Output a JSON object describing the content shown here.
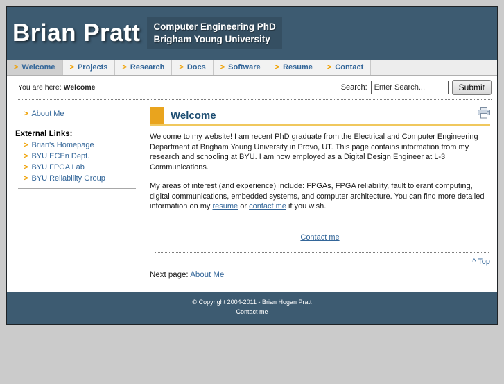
{
  "colors": {
    "header_bg": "#3d5b71",
    "accent_square": "#e9a41e",
    "accent_underline": "#f0c85e",
    "arrow_orange": "#efa000",
    "link_blue": "#336699",
    "page_bg": "#cbcbcb"
  },
  "header": {
    "title": "Brian Pratt",
    "subtitle_line1": "Computer Engineering PhD",
    "subtitle_line2": "Brigham Young University"
  },
  "nav": {
    "items": [
      {
        "label": "Welcome",
        "active": true
      },
      {
        "label": "Projects",
        "active": false
      },
      {
        "label": "Research",
        "active": false
      },
      {
        "label": "Docs",
        "active": false
      },
      {
        "label": "Software",
        "active": false
      },
      {
        "label": "Resume",
        "active": false
      },
      {
        "label": "Contact",
        "active": false
      }
    ]
  },
  "breadcrumb": {
    "prefix": "You are here:",
    "current": "Welcome"
  },
  "search": {
    "label": "Search:",
    "placeholder": "Enter Search...",
    "submit_label": "Submit"
  },
  "sidebar": {
    "about_link": "About Me",
    "external_links_heading": "External Links:",
    "links": [
      "Brian's Homepage",
      "BYU ECEn Dept.",
      "BYU FPGA Lab",
      "BYU Reliability Group"
    ]
  },
  "main": {
    "heading": "Welcome",
    "paragraph1": "Welcome to my website! I am recent PhD graduate from the Electrical and Computer Engineering Department at Brigham Young University in Provo, UT. This page contains information from my research and schooling at BYU. I am now employed as a Digital Design Engineer at L-3 Communications.",
    "paragraph2_pre": "My areas of interest (and experience) include: FPGAs, FPGA reliability, fault tolerant computing, digital communications, embedded systems, and computer architecture.  You can find more detailed information on my ",
    "resume_link": "resume",
    "paragraph2_mid": " or ",
    "contact_link": "contact me",
    "paragraph2_post": " if you wish.",
    "center_contact_link": "Contact me",
    "top_link": "^ Top",
    "next_page_label": "Next page:",
    "next_page_link": "About Me"
  },
  "footer": {
    "copyright": "© Copyright 2004-2011 - Brian Hogan Pratt",
    "contact_link": "Contact me"
  }
}
